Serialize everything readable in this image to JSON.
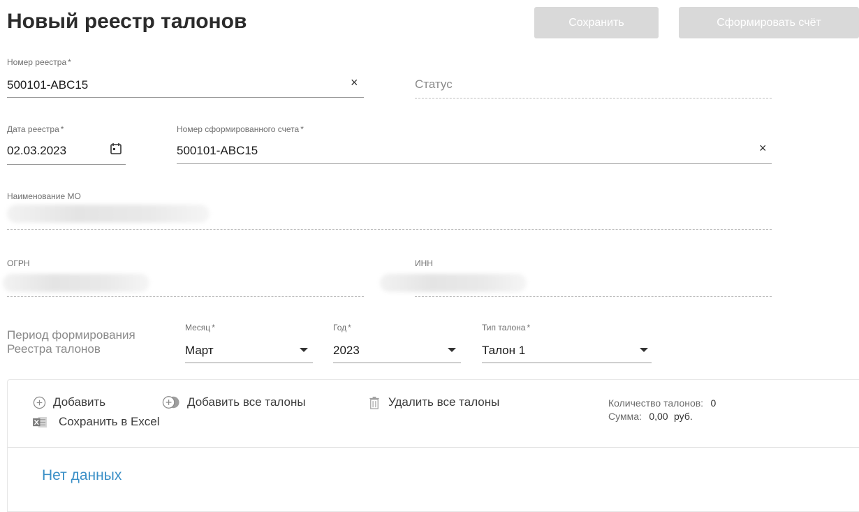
{
  "page": {
    "title": "Новый реестр талонов"
  },
  "toolbar": {
    "save_label": "Сохранить",
    "invoice_label": "Сформировать счёт"
  },
  "registry_number": {
    "label": "Номер реестра",
    "required_mark": "*",
    "value": "500101-ABC15"
  },
  "status": {
    "placeholder": "Статус"
  },
  "registry_date": {
    "label": "Дата реестра",
    "required_mark": "*",
    "value": "02.03.2023"
  },
  "invoice_number": {
    "label": "Номер сформированного счета",
    "required_mark": "*",
    "value": "500101-ABC15"
  },
  "mo_name": {
    "label": "Наименование МО"
  },
  "ogrn": {
    "label": "ОГРН"
  },
  "inn": {
    "label": "ИНН"
  },
  "period": {
    "caption_line1": "Период формирования",
    "caption_line2": "Реестра талонов",
    "month": {
      "label": "Месяц",
      "required_mark": "*",
      "value": "Март"
    },
    "year": {
      "label": "Год",
      "required_mark": "*",
      "value": "2023"
    },
    "ticket_type": {
      "label": "Тип талона",
      "required_mark": "*",
      "value": "Талон 1"
    }
  },
  "actions": {
    "add": "Добавить",
    "add_all": "Добавить все талоны",
    "delete_all": "Удалить все талоны",
    "export_excel": "Сохранить в Excel"
  },
  "summary": {
    "count_label": "Количество талонов:",
    "count_value": "0",
    "sum_label": "Сумма:",
    "sum_value": "0,00",
    "currency": "руб."
  },
  "table": {
    "empty_text": "Нет данных"
  },
  "icons": {
    "clear": "×",
    "calendar": "calendar-icon",
    "dropdown": "caret-down-icon",
    "add": "plus-circle-icon",
    "add_all": "plus-circle-filled-icon",
    "delete": "trash-icon",
    "excel": "excel-icon"
  }
}
